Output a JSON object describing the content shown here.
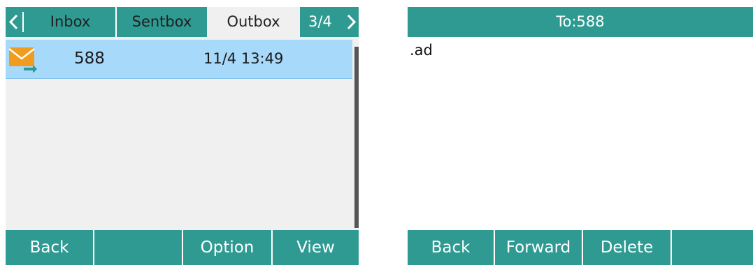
{
  "left_screen": {
    "tabs": {
      "prev_icon": "chevron-left-icon",
      "items": [
        "Inbox",
        "Sentbox",
        "Outbox"
      ],
      "selected": "Outbox",
      "page_counter": "3/4",
      "next_icon": "chevron-right-icon"
    },
    "messages": [
      {
        "icon": "outgoing-mail-icon",
        "number": "588",
        "time": "11/4 13:49",
        "selected": true
      }
    ],
    "softkeys": [
      "Back",
      "",
      "Option",
      "View"
    ]
  },
  "right_screen": {
    "title": "To:588",
    "body": ".ad",
    "softkeys": [
      "Back",
      "Forward",
      "Delete",
      ""
    ]
  },
  "colors": {
    "header_teal": "#2f9a92",
    "selected_row": "#a7d9fa",
    "list_background": "#f0f0f0",
    "mail_icon_orange": "#f29c1f",
    "mail_icon_arrow": "#2f9a92"
  }
}
